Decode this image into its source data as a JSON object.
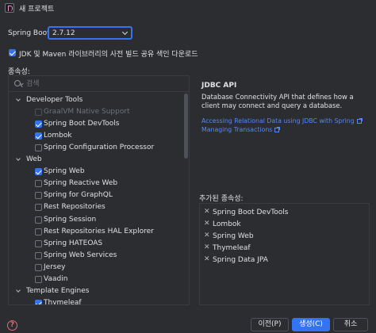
{
  "window": {
    "title": "새 프로젝트"
  },
  "spring_boot": {
    "label": "Spring Boot:",
    "selected": "2.7.12"
  },
  "jdk_checkbox": {
    "label": "JDK 및 Maven 라이브러리의 사전 빌드 공유 색인 다운로드",
    "checked": true
  },
  "dependencies": {
    "label": "종속성:",
    "search_placeholder": "검색",
    "tree": [
      {
        "kind": "group",
        "label": "Developer Tools"
      },
      {
        "kind": "item",
        "label": "GraalVM Native Support",
        "checked": false,
        "disabled": true
      },
      {
        "kind": "item",
        "label": "Spring Boot DevTools",
        "checked": true
      },
      {
        "kind": "item",
        "label": "Lombok",
        "checked": true
      },
      {
        "kind": "item",
        "label": "Spring Configuration Processor",
        "checked": false
      },
      {
        "kind": "group",
        "label": "Web"
      },
      {
        "kind": "item",
        "label": "Spring Web",
        "checked": true
      },
      {
        "kind": "item",
        "label": "Spring Reactive Web",
        "checked": false
      },
      {
        "kind": "item",
        "label": "Spring for GraphQL",
        "checked": false
      },
      {
        "kind": "item",
        "label": "Rest Repositories",
        "checked": false
      },
      {
        "kind": "item",
        "label": "Spring Session",
        "checked": false
      },
      {
        "kind": "item",
        "label": "Rest Repositories HAL Explorer",
        "checked": false
      },
      {
        "kind": "item",
        "label": "Spring HATEOAS",
        "checked": false
      },
      {
        "kind": "item",
        "label": "Spring Web Services",
        "checked": false
      },
      {
        "kind": "item",
        "label": "Jersey",
        "checked": false
      },
      {
        "kind": "item",
        "label": "Vaadin",
        "checked": false
      },
      {
        "kind": "group",
        "label": "Template Engines"
      },
      {
        "kind": "item",
        "label": "Thymeleaf",
        "checked": true
      }
    ]
  },
  "info": {
    "title": "JDBC API",
    "description": "Database Connectivity API that defines how a client may connect and query a database.",
    "links": [
      "Accessing Relational Data using JDBC with Spring",
      "Managing Transactions"
    ]
  },
  "added": {
    "label": "추가된 종속성:",
    "items": [
      "Spring Boot DevTools",
      "Lombok",
      "Spring Web",
      "Thymeleaf",
      "Spring Data JPA"
    ]
  },
  "buttons": {
    "help": "?",
    "previous": "이전(P)",
    "create": "생성(C)",
    "cancel": "취소"
  },
  "colors": {
    "accent": "#3574f0",
    "link": "#548af7",
    "background": "#2b2d30"
  }
}
